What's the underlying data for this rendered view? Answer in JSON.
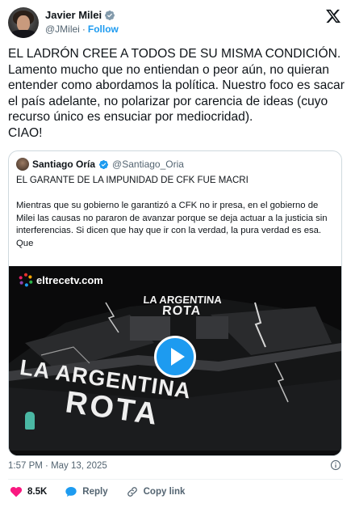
{
  "post": {
    "author_name": "Javier Milei",
    "handle": "@JMilei",
    "separator": "·",
    "follow_label": "Follow",
    "text": "EL LADRÓN CREE A TODOS DE SU MISMA CONDICIÓN.\nLamento mucho que no entiendan o peor aún, no quieran entender como abordamos la política. Nuestro foco es sacar el país adelante, no polarizar por carencia de ideas (cuyo recurso único es ensuciar por mediocridad).\nCIAO!",
    "time": "1:57 PM",
    "date": "May 13, 2025",
    "meta_separator": "·"
  },
  "quote": {
    "author_name": "Santiago Oría",
    "handle": "@Santiago_Oria",
    "title": "EL GARANTE DE LA IMPUNIDAD DE CFK FUE MACRI",
    "body": "Mientras que su gobierno le garantizó a CFK no ir presa, en el gobierno de Milei las causas no pararon de avanzar porque se deja actuar a la justicia sin interferencias. Si dicen que hay que ir con la verdad, la pura verdad es esa. Que",
    "video": {
      "brand": "eltrecetv.com",
      "sign_small_line1": "LA ARGENTINA",
      "sign_small_line2": "ROTA",
      "sign_big_line1": "LA ARGENTINA",
      "sign_big_line2": "ROTA"
    }
  },
  "actions": {
    "likes": "8.5K",
    "reply_label": "Reply",
    "copy_label": "Copy link"
  },
  "colors": {
    "accent": "#1d9bf0",
    "like": "#f91880",
    "muted": "#536471"
  },
  "icons": [
    "verified-badge-icon",
    "x-logo-icon",
    "play-icon",
    "info-icon",
    "heart-icon",
    "reply-icon",
    "link-icon"
  ]
}
